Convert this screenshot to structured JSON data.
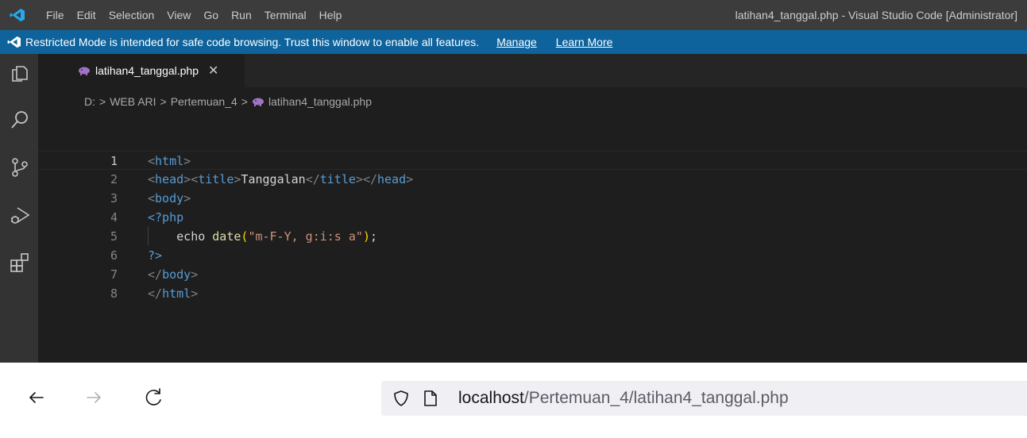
{
  "vscode": {
    "menu": [
      "File",
      "Edit",
      "Selection",
      "View",
      "Go",
      "Run",
      "Terminal",
      "Help"
    ],
    "window_title": "latihan4_tanggal.php - Visual Studio Code [Administrator]",
    "banner": {
      "message": "Restricted Mode is intended for safe code browsing. Trust this window to enable all features.",
      "manage_label": "Manage",
      "learn_more_label": "Learn More"
    },
    "activity_icons": [
      "explorer-icon",
      "search-icon",
      "source-control-icon",
      "run-debug-icon",
      "extensions-icon"
    ],
    "tab": {
      "label": "latihan4_tanggal.php",
      "close_glyph": "✕"
    },
    "breadcrumb": [
      "D:",
      "WEB ARI",
      "Pertemuan_4",
      "latihan4_tanggal.php"
    ],
    "code_lines": [
      {
        "num": "1",
        "text": "<html>"
      },
      {
        "num": "2",
        "text": "<head><title>Tanggalan</title></head>"
      },
      {
        "num": "3",
        "text": "<body>"
      },
      {
        "num": "4",
        "text": "<?php"
      },
      {
        "num": "5",
        "text": "    echo date(\"m-F-Y, g:i:s a\");"
      },
      {
        "num": "6",
        "text": "?>"
      },
      {
        "num": "7",
        "text": "</body>"
      },
      {
        "num": "8",
        "text": "</html>"
      }
    ]
  },
  "browser": {
    "url_host": "localhost",
    "url_path": "/Pertemuan_4/latihan4_tanggal.php",
    "nav_icons": [
      "back-arrow-icon",
      "forward-arrow-icon",
      "reload-icon"
    ]
  },
  "colors": {
    "titlebar": "#3c3c3c",
    "banner": "#0e639c",
    "activitybar": "#333333",
    "editor": "#1e1e1e",
    "tag": "#569cd6",
    "string": "#ce9178",
    "function": "#dcdcaa"
  }
}
